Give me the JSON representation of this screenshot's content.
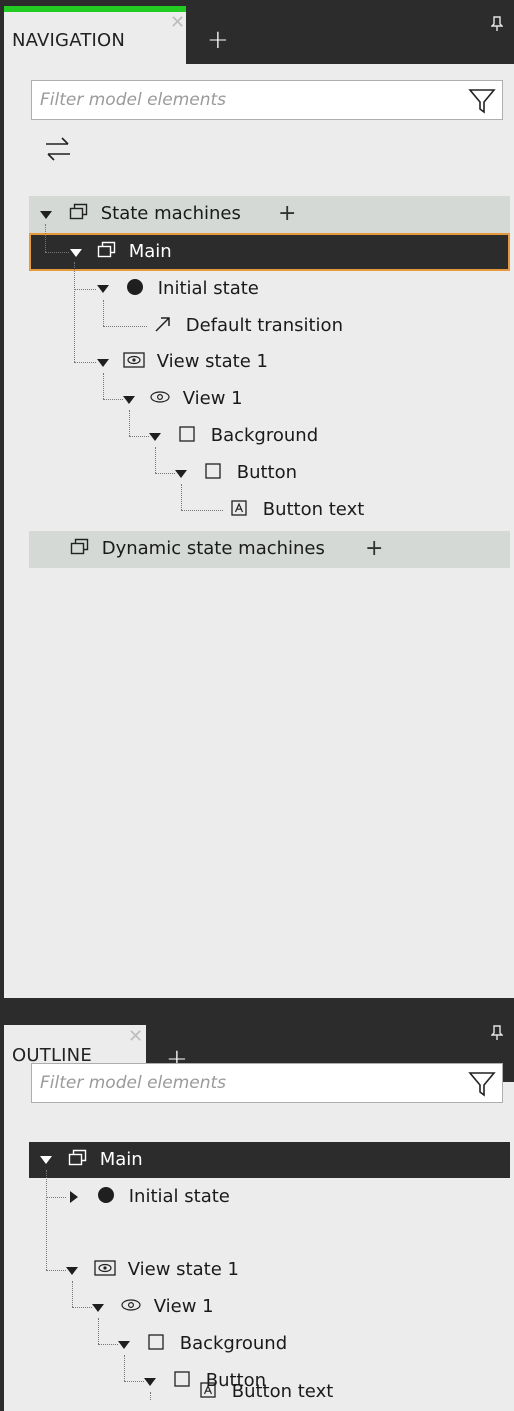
{
  "navigation": {
    "tab_label": "NAVIGATION",
    "filter_placeholder": "Filter model elements",
    "tree": {
      "state_machines": "State machines",
      "main": "Main",
      "initial_state": "Initial state",
      "default_transition": "Default transition",
      "view_state": "View state 1",
      "view": "View 1",
      "background": "Background",
      "button": "Button",
      "button_text": "Button text",
      "dynamic_state_machines": "Dynamic state machines"
    }
  },
  "outline": {
    "tab_label": "OUTLINE",
    "filter_placeholder": "Filter model elements",
    "tree": {
      "main": "Main",
      "initial_state": "Initial state",
      "view_state": "View state 1",
      "view": "View 1",
      "background": "Background",
      "button": "Button",
      "button_text": "Button text"
    }
  },
  "colors": {
    "accent_green": "#22cc22",
    "selection_border": "#e79a3c",
    "dark_bar": "#2c2c2c",
    "panel_bg": "#ececec",
    "group_row_bg": "#d4d9d5"
  },
  "icons": {
    "close": "close-icon",
    "add": "plus-icon",
    "pin": "pin-icon",
    "filter": "funnel-icon",
    "swap": "swap-arrows-icon",
    "state_machine": "state-machine-icon",
    "initial_state": "filled-circle-icon",
    "transition": "arrow-up-right-icon",
    "view_state": "eye-box-icon",
    "view": "eye-icon",
    "rectangle": "square-icon",
    "text": "text-box-icon"
  }
}
